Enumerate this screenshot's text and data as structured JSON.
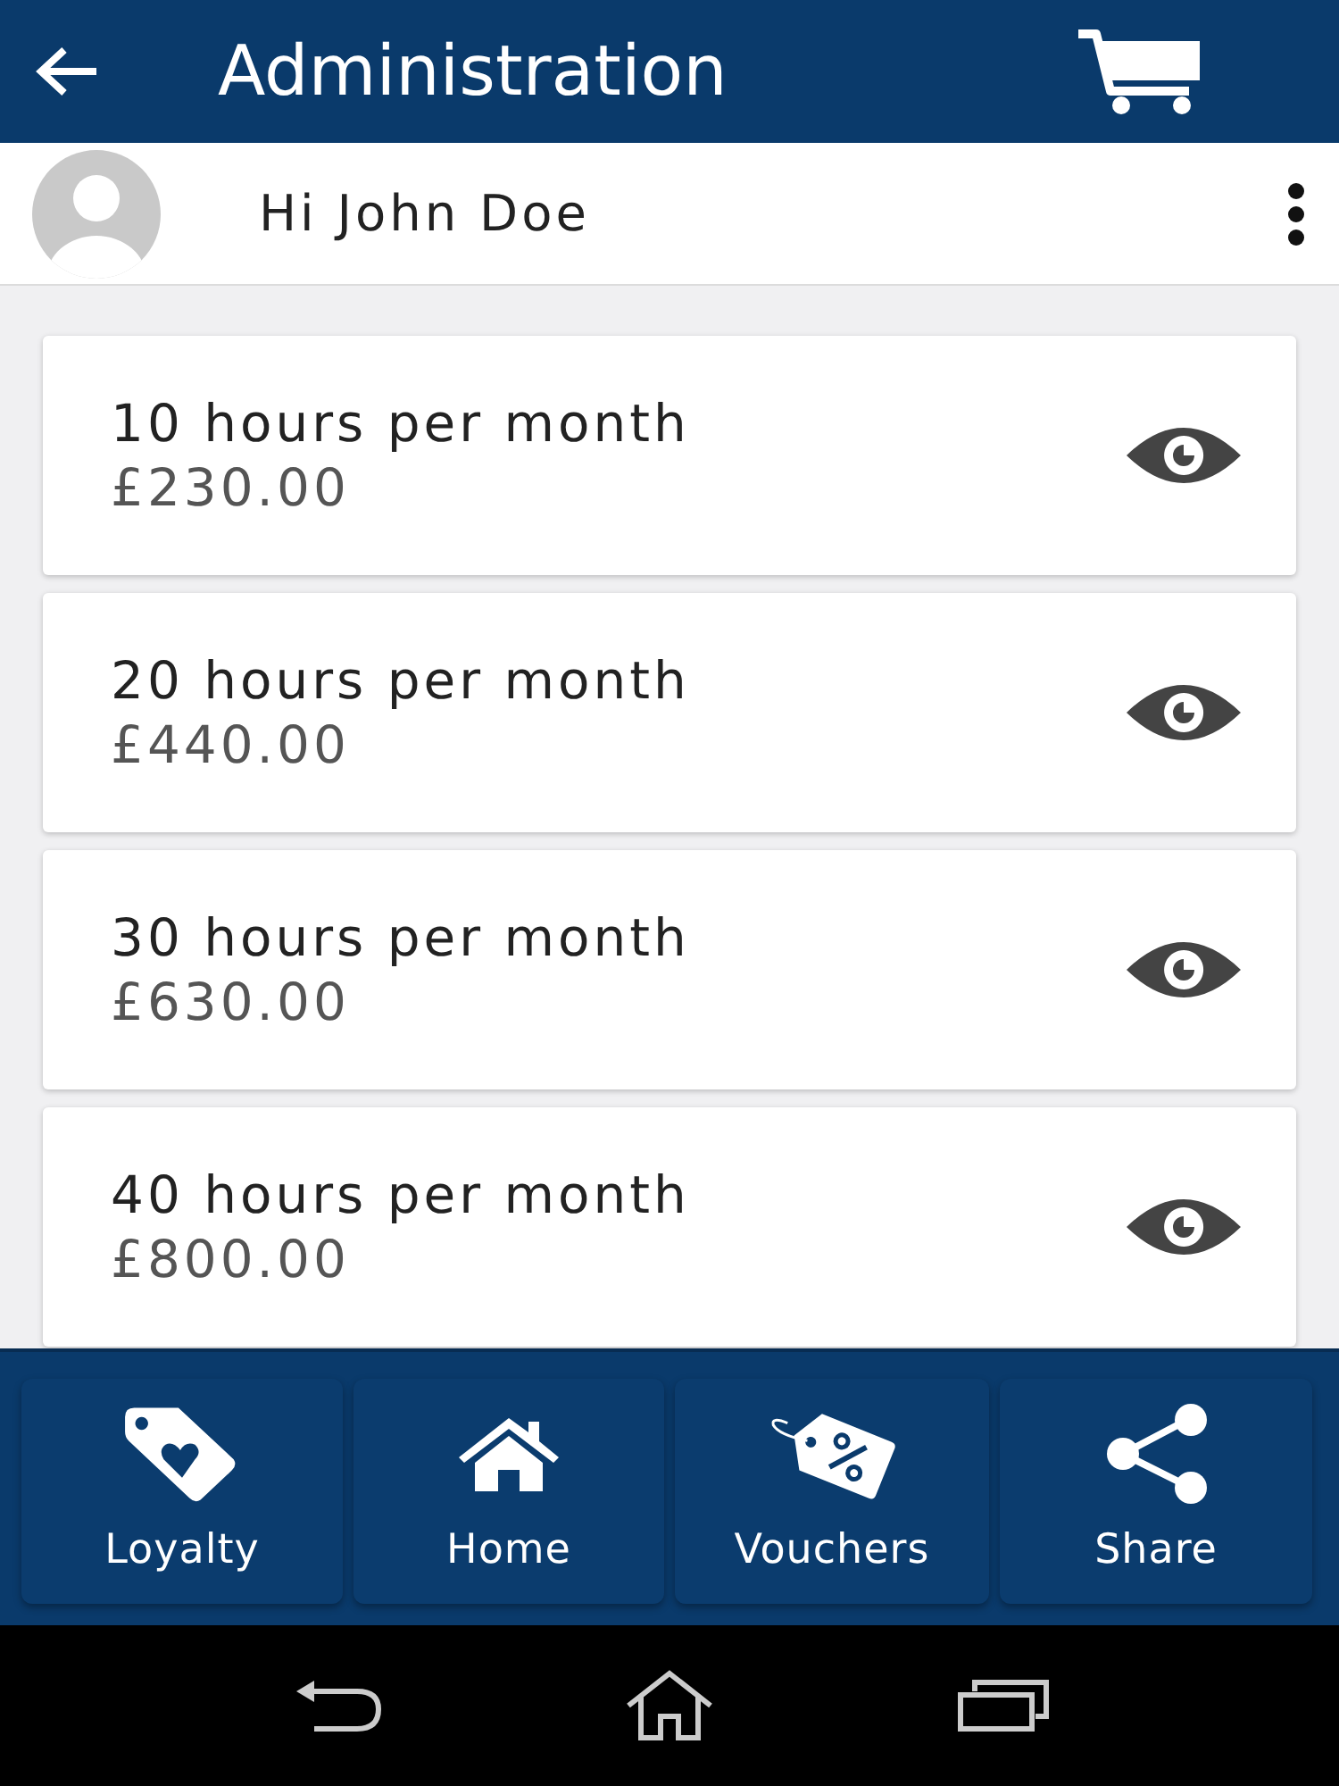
{
  "header": {
    "title": "Administration"
  },
  "user": {
    "greeting": "Hi John Doe"
  },
  "plans": [
    {
      "name": "10 hours per month",
      "price": "£230.00"
    },
    {
      "name": "20 hours per month",
      "price": "£440.00"
    },
    {
      "name": "30 hours per month",
      "price": "£630.00"
    },
    {
      "name": "40 hours per month",
      "price": "£800.00"
    }
  ],
  "bottom_nav": [
    {
      "kind": "loyalty",
      "label": "Loyalty"
    },
    {
      "kind": "home",
      "label": "Home"
    },
    {
      "kind": "vouchers",
      "label": "Vouchers"
    },
    {
      "kind": "share",
      "label": "Share"
    }
  ]
}
